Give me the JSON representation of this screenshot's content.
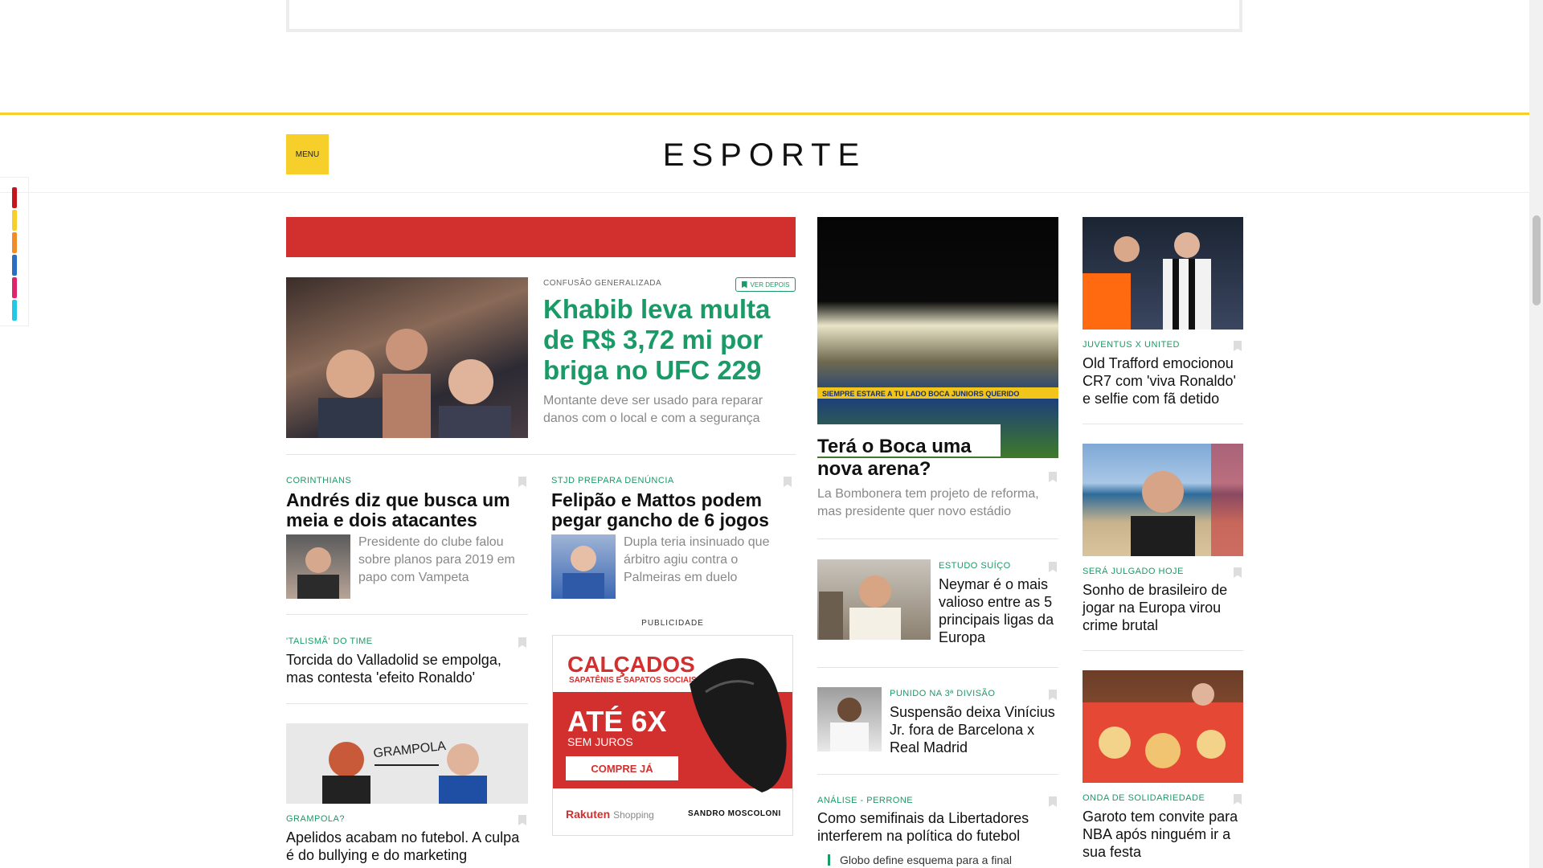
{
  "header": {
    "menu_label": "MENU",
    "section_title": "ESPORTE"
  },
  "side_rail_colors": [
    "#c6161d",
    "#f7cf2a",
    "#f28c28",
    "#2b6fc4",
    "#e0246b",
    "#22c8e6"
  ],
  "main_story": {
    "kicker": "CONFUSÃO GENERALIZADA",
    "save_label": "VER DEPOIS",
    "headline": "Khabib leva multa de R$ 3,72 mi por briga no UFC 229",
    "description": "Montante deve ser usado para reparar danos com o local e com a segurança"
  },
  "stories": {
    "corinthians": {
      "kicker": "CORINTHIANS",
      "headline": "Andrés diz que busca um meia e dois atacantes",
      "description": "Presidente do clube falou sobre planos para 2019 em papo com Vampeta"
    },
    "stjd": {
      "kicker": "STJD PREPARA DENÚNCIA",
      "headline": "Felipão e Mattos podem pegar gancho de 6 jogos",
      "description": "Dupla teria insinuado que árbitro agiu contra o Palmeiras em duelo"
    },
    "valladolid": {
      "kicker": "'TALISMÃ' DO TIME",
      "headline": "Torcida do Valladolid se empolga, mas contesta 'efeito Ronaldo'"
    },
    "grampola": {
      "kicker": "GRAMPOLA?",
      "headline": "Apelidos acabam no futebol. A culpa é do bullying e do marketing",
      "image_text": "GRAMPOLA"
    },
    "boca": {
      "headline": "Terá o Boca uma nova arena?",
      "description": "La Bombonera tem projeto de reforma, mas presidente quer novo estádio",
      "banner_text": "SIEMPRE ESTARE A TU LADO BOCA JUNIORS QUERIDO"
    },
    "neymar": {
      "kicker": "ESTUDO SUÍÇO",
      "headline": "Neymar é o mais valioso entre as 5 principais ligas da Europa"
    },
    "vinicius": {
      "kicker": "PUNIDO NA 3ª DIVISÃO",
      "headline": "Suspensão deixa Vinícius Jr. fora de Barcelona x Real Madrid"
    },
    "libertadores": {
      "kicker": "ANÁLISE - PERRONE",
      "headline": "Como semifinais da Libertadores interferem na política do futebol",
      "sub_item": "Globo define esquema para a final"
    },
    "juventus": {
      "kicker": "JUVENTUS X UNITED",
      "headline": "Old Trafford emocionou CR7 com 'viva Ronaldo' e selfie com fã detido"
    },
    "brasileiro": {
      "kicker": "SERÁ JULGADO HOJE",
      "headline": "Sonho de brasileiro de jogar na Europa virou crime brutal"
    },
    "nba": {
      "kicker": "ONDA DE SOLIDARIEDADE",
      "headline": "Garoto tem convite para NBA após ninguém ir a sua festa"
    }
  },
  "ad": {
    "label": "PUBLICIDADE",
    "title": "CALÇADOS",
    "subtitle": "SAPATÊNIS E SAPATOS SOCIAIS",
    "offer": "ATÉ 6X",
    "offer_sub": "SEM JUROS",
    "cta": "COMPRE JÁ",
    "brand_left": "Rakuten",
    "brand_left_suffix": "Shopping",
    "brand_right": "SANDRO MOSCOLONI"
  }
}
